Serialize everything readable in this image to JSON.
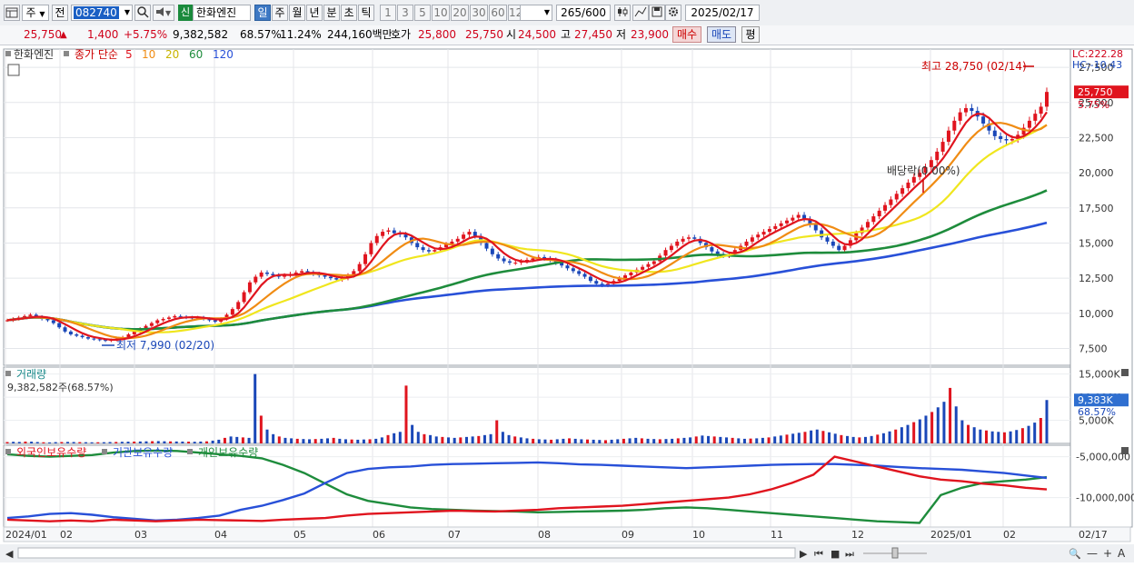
{
  "toolbar": {
    "type_label": "주",
    "prev_label": "전",
    "code": "082740",
    "stock_name": "한화엔진",
    "stock_badge": "신",
    "periods": [
      "일",
      "주",
      "월",
      "년",
      "분",
      "초",
      "틱"
    ],
    "active_period": "일",
    "intervals": [
      "1",
      "3",
      "5",
      "10",
      "20",
      "30",
      "60",
      "120"
    ],
    "count": "265",
    "count_total": "/600",
    "date": "2025/02/17"
  },
  "quote": {
    "price": "25,750",
    "change_arrow": "▲",
    "change": "1,400",
    "change_pct": "+5.75%",
    "volume": "9,382,582",
    "volume_ratio": "68.57%",
    "turnover": "11.24%",
    "amount": "244,160백만",
    "bid_label": "호가",
    "ask_price": "25,800",
    "bid_price": "25,750",
    "open_label": "시",
    "open": "24,500",
    "high_label": "고",
    "high": "27,450",
    "low_label": "저",
    "low": "23,900",
    "buy_label": "매수",
    "sell_label": "매도",
    "flat_label": "평"
  },
  "icons": {
    "layout": "layout-icon",
    "dropdown": "chevron-down-icon",
    "search": "search-icon",
    "sound": "speaker-icon",
    "settings": "gear-icon",
    "save": "save-icon",
    "calculator": "calculator-icon"
  },
  "chart_data": {
    "type": "line",
    "price_legend": {
      "stock": "한화엔진",
      "ma_label": "종가 단순",
      "ma_periods": [
        {
          "period": "5",
          "color": "#e0141e"
        },
        {
          "period": "10",
          "color": "#f08c14"
        },
        {
          "period": "20",
          "color": "#f0e61e"
        },
        {
          "period": "60",
          "color": "#1e8c3c"
        },
        {
          "period": "120",
          "color": "#2850d8"
        }
      ]
    },
    "lc_label": "LC:222.28",
    "hc_label": "HC:-10.43",
    "price_ticks": [
      27500,
      25000,
      22500,
      20000,
      17500,
      15000,
      12500,
      10000,
      7500
    ],
    "price_tick_labels": [
      "27,500",
      "25,000",
      "22,500",
      "20,000",
      "17,500",
      "15,000",
      "12,500",
      "10,000",
      "7,500"
    ],
    "price_range": [
      6300,
      28800
    ],
    "current_price_label": "25,750",
    "current_pct_label": "5.75%",
    "high_annotation": "최고 28,750 (02/14)",
    "low_annotation": "최저 7,990 (02/20)",
    "dividend_annotation": "배당락(0.00%)",
    "x_axis_labels": [
      "2024/01",
      "02",
      "03",
      "04",
      "05",
      "06",
      "07",
      "08",
      "09",
      "10",
      "11",
      "12",
      "2025/01",
      "02",
      "02/17"
    ],
    "closes": [
      9500,
      9600,
      9700,
      9800,
      9900,
      9750,
      9600,
      9500,
      9300,
      9000,
      8700,
      8500,
      8400,
      8300,
      8200,
      8150,
      8100,
      8050,
      8100,
      8200,
      8300,
      8500,
      8700,
      8900,
      9100,
      9300,
      9500,
      9600,
      9700,
      9800,
      9750,
      9700,
      9650,
      9700,
      9600,
      9500,
      9400,
      9600,
      9900,
      10300,
      10800,
      11500,
      12200,
      12600,
      12900,
      12800,
      12700,
      12600,
      12700,
      12800,
      12900,
      13000,
      12900,
      12800,
      12700,
      12600,
      12500,
      12400,
      12500,
      12700,
      13000,
      13500,
      14200,
      15000,
      15500,
      15800,
      15900,
      15700,
      15600,
      15400,
      15000,
      14700,
      14500,
      14400,
      14500,
      14700,
      14900,
      15100,
      15300,
      15600,
      15800,
      15500,
      15000,
      14600,
      14200,
      13900,
      13700,
      13600,
      13600,
      13700,
      13800,
      13900,
      14000,
      13900,
      13800,
      13600,
      13400,
      13200,
      13000,
      12800,
      12600,
      12300,
      12100,
      12000,
      12100,
      12300,
      12500,
      12700,
      12900,
      13100,
      13300,
      13500,
      13700,
      14100,
      14500,
      14800,
      15100,
      15300,
      15400,
      15300,
      15000,
      14700,
      14400,
      14200,
      14100,
      14200,
      14500,
      14800,
      15100,
      15400,
      15600,
      15800,
      16000,
      16200,
      16400,
      16600,
      16800,
      17000,
      16700,
      16300,
      15900,
      15400,
      15100,
      14800,
      14500,
      14800,
      15200,
      15700,
      16100,
      16500,
      16900,
      17300,
      17700,
      18100,
      18500,
      18900,
      19300,
      19700,
      20000,
      20400,
      20900,
      21500,
      22200,
      23000,
      23700,
      24300,
      24600,
      24400,
      24000,
      23500,
      23000,
      22600,
      22400,
      22300,
      22400,
      22700,
      23200,
      23700,
      24200,
      24700,
      25750
    ],
    "volume_label": "거래량",
    "volume_value_label": "9,382,582주(68.57%)",
    "volume_ticks": [
      "15,000K",
      "10,000K",
      "5,000K"
    ],
    "volume_current_label": "9,383K",
    "volume_pct_label": "68.57%",
    "volumes": [
      300,
      350,
      320,
      400,
      380,
      300,
      250,
      220,
      280,
      300,
      330,
      300,
      280,
      260,
      240,
      250,
      260,
      300,
      320,
      350,
      380,
      400,
      420,
      450,
      480,
      500,
      460,
      440,
      420,
      400,
      380,
      360,
      400,
      450,
      600,
      800,
      1200,
      1500,
      1400,
      1300,
      1200,
      15000,
      6000,
      3000,
      2000,
      1500,
      1200,
      1100,
      1000,
      950,
      900,
      950,
      1000,
      1100,
      1200,
      1000,
      900,
      850,
      800,
      850,
      900,
      1000,
      1300,
      1800,
      2200,
      2500,
      12500,
      4000,
      2500,
      2000,
      1800,
      1500,
      1400,
      1300,
      1200,
      1300,
      1400,
      1500,
      1600,
      1800,
      2000,
      5000,
      2500,
      1800,
      1500,
      1300,
      1100,
      1000,
      900,
      850,
      800,
      900,
      1000,
      1100,
      1000,
      900,
      850,
      800,
      750,
      700,
      800,
      900,
      1000,
      1100,
      1200,
      1100,
      1000,
      950,
      900,
      950,
      1000,
      1100,
      1200,
      1300,
      1500,
      1700,
      1600,
      1500,
      1400,
      1300,
      1200,
      1100,
      1000,
      1050,
      1100,
      1200,
      1300,
      1500,
      1700,
      1900,
      2100,
      2300,
      2500,
      2800,
      3000,
      2700,
      2400,
      2100,
      1800,
      1600,
      1400,
      1300,
      1400,
      1600,
      1900,
      2200,
      2600,
      3000,
      3500,
      4000,
      4600,
      5200,
      6000,
      6800,
      7800,
      9000,
      12000,
      8000,
      5000,
      4000,
      3500,
      3000,
      2800,
      2600,
      2500,
      2400,
      2600,
      2900,
      3300,
      3800,
      4500,
      5500,
      9383
    ],
    "holdings_legend": [
      {
        "label": "외국인보유수량",
        "color": "#e0141e"
      },
      {
        "label": "기관보유수량",
        "color": "#2850d8"
      },
      {
        "label": "개인보유수량",
        "color": "#1e8c3c"
      }
    ],
    "holdings_ticks": [
      "-5,000,000",
      "-10,000,000"
    ],
    "holdings_range": [
      -13600000,
      -3600000
    ],
    "foreign": [
      -12700000,
      -12800000,
      -12900000,
      -12800000,
      -12900000,
      -12700000,
      -12800000,
      -12900000,
      -12800000,
      -12700000,
      -12750000,
      -12800000,
      -12850000,
      -12700000,
      -12600000,
      -12500000,
      -12200000,
      -12000000,
      -11900000,
      -11800000,
      -11700000,
      -11600000,
      -11650000,
      -11700000,
      -11600000,
      -11500000,
      -11300000,
      -11200000,
      -11100000,
      -11000000,
      -10800000,
      -10600000,
      -10400000,
      -10200000,
      -10000000,
      -9600000,
      -9000000,
      -8200000,
      -7200000,
      -5000000,
      -5600000,
      -6200000,
      -6800000,
      -7400000,
      -7800000,
      -8000000,
      -8300000,
      -8500000,
      -8800000,
      -9000000
    ],
    "institution": [
      -12500000,
      -12300000,
      -12000000,
      -11900000,
      -12100000,
      -12400000,
      -12600000,
      -12800000,
      -12700000,
      -12500000,
      -12200000,
      -11500000,
      -11000000,
      -10300000,
      -9500000,
      -8200000,
      -7000000,
      -6500000,
      -6300000,
      -6200000,
      -6000000,
      -5900000,
      -5850000,
      -5800000,
      -5750000,
      -5700000,
      -5800000,
      -5950000,
      -6000000,
      -6100000,
      -6200000,
      -6300000,
      -6400000,
      -6300000,
      -6200000,
      -6100000,
      -6000000,
      -5950000,
      -5900000,
      -5900000,
      -6000000,
      -6100000,
      -6250000,
      -6400000,
      -6500000,
      -6600000,
      -6800000,
      -7000000,
      -7300000,
      -7600000
    ],
    "individual": [
      -4700000,
      -4900000,
      -5000000,
      -4900000,
      -4800000,
      -4500000,
      -4300000,
      -4250000,
      -4300000,
      -4500000,
      -4700000,
      -4900000,
      -5200000,
      -6000000,
      -7000000,
      -8300000,
      -9600000,
      -10400000,
      -10800000,
      -11200000,
      -11400000,
      -11500000,
      -11600000,
      -11650000,
      -11700000,
      -11800000,
      -11750000,
      -11700000,
      -11650000,
      -11600000,
      -11500000,
      -11300000,
      -11200000,
      -11300000,
      -11500000,
      -11700000,
      -11900000,
      -12100000,
      -12300000,
      -12500000,
      -12700000,
      -12900000,
      -13000000,
      -13100000,
      -9700000,
      -8800000,
      -8200000,
      -8000000,
      -7800000,
      -7500000
    ]
  }
}
